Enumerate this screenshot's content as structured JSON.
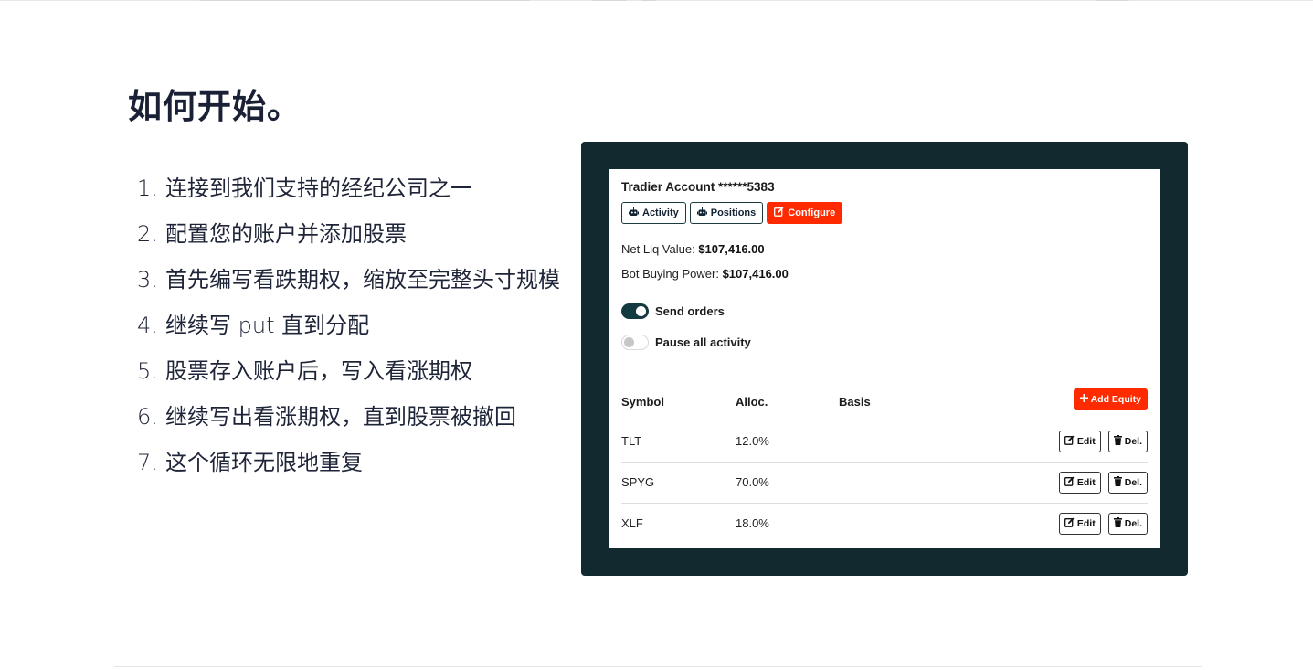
{
  "heading": "如何开始。",
  "steps": [
    {
      "num": "1.",
      "text": "连接到我们支持的经纪公司之一"
    },
    {
      "num": "2.",
      "text": "配置您的账户并添加股票"
    },
    {
      "num": "3.",
      "text": "首先编写看跌期权，缩放至完整头寸规模"
    },
    {
      "num": "4.",
      "text": "继续写 put 直到分配"
    },
    {
      "num": "5.",
      "text": "股票存入账户后，写入看涨期权"
    },
    {
      "num": "6.",
      "text": "继续写出看涨期权，直到股票被撤回"
    },
    {
      "num": "7.",
      "text": "这个循环无限地重复"
    }
  ],
  "account": {
    "title": "Tradier Account ******5383",
    "buttons": {
      "activity": "Activity",
      "positions": "Positions",
      "configure": "Configure"
    },
    "net_liq_label": "Net Liq Value:",
    "net_liq_value": "$107,416.00",
    "buying_power_label": "Bot Buying Power:",
    "buying_power_value": "$107,416.00",
    "toggles": [
      {
        "label": "Send orders",
        "on": true
      },
      {
        "label": "Pause all activity",
        "on": false
      }
    ],
    "table": {
      "headers": {
        "symbol": "Symbol",
        "alloc": "Alloc.",
        "basis": "Basis"
      },
      "add_label": "Add Equity",
      "rows": [
        {
          "symbol": "TLT",
          "alloc": "12.0%",
          "basis": ""
        },
        {
          "symbol": "SPYG",
          "alloc": "70.0%",
          "basis": ""
        },
        {
          "symbol": "XLF",
          "alloc": "18.0%",
          "basis": ""
        }
      ],
      "edit_label": "Edit",
      "delete_label": "Del."
    }
  },
  "colors": {
    "accent": "#ff2a00",
    "frame": "#122a2f",
    "heading": "#1a2035"
  }
}
